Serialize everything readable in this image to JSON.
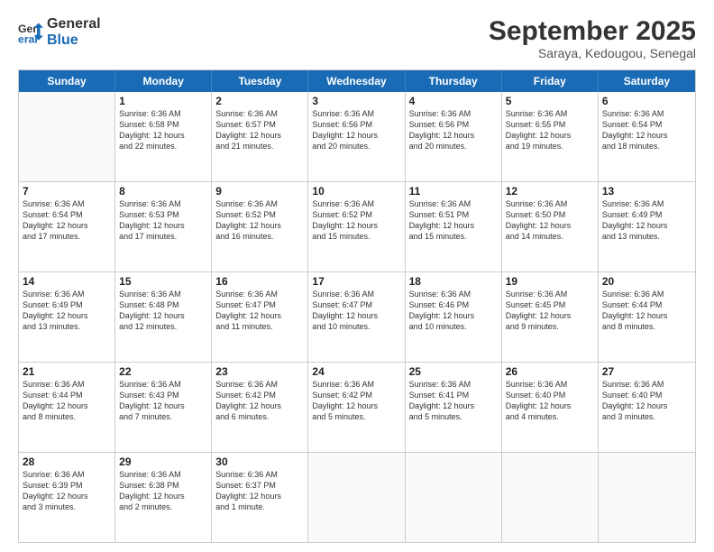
{
  "logo": {
    "line1": "General",
    "line2": "Blue"
  },
  "title": "September 2025",
  "subtitle": "Saraya, Kedougou, Senegal",
  "days": [
    "Sunday",
    "Monday",
    "Tuesday",
    "Wednesday",
    "Thursday",
    "Friday",
    "Saturday"
  ],
  "weeks": [
    [
      {
        "num": "",
        "info": ""
      },
      {
        "num": "1",
        "info": "Sunrise: 6:36 AM\nSunset: 6:58 PM\nDaylight: 12 hours\nand 22 minutes."
      },
      {
        "num": "2",
        "info": "Sunrise: 6:36 AM\nSunset: 6:57 PM\nDaylight: 12 hours\nand 21 minutes."
      },
      {
        "num": "3",
        "info": "Sunrise: 6:36 AM\nSunset: 6:56 PM\nDaylight: 12 hours\nand 20 minutes."
      },
      {
        "num": "4",
        "info": "Sunrise: 6:36 AM\nSunset: 6:56 PM\nDaylight: 12 hours\nand 20 minutes."
      },
      {
        "num": "5",
        "info": "Sunrise: 6:36 AM\nSunset: 6:55 PM\nDaylight: 12 hours\nand 19 minutes."
      },
      {
        "num": "6",
        "info": "Sunrise: 6:36 AM\nSunset: 6:54 PM\nDaylight: 12 hours\nand 18 minutes."
      }
    ],
    [
      {
        "num": "7",
        "info": "Sunrise: 6:36 AM\nSunset: 6:54 PM\nDaylight: 12 hours\nand 17 minutes."
      },
      {
        "num": "8",
        "info": "Sunrise: 6:36 AM\nSunset: 6:53 PM\nDaylight: 12 hours\nand 17 minutes."
      },
      {
        "num": "9",
        "info": "Sunrise: 6:36 AM\nSunset: 6:52 PM\nDaylight: 12 hours\nand 16 minutes."
      },
      {
        "num": "10",
        "info": "Sunrise: 6:36 AM\nSunset: 6:52 PM\nDaylight: 12 hours\nand 15 minutes."
      },
      {
        "num": "11",
        "info": "Sunrise: 6:36 AM\nSunset: 6:51 PM\nDaylight: 12 hours\nand 15 minutes."
      },
      {
        "num": "12",
        "info": "Sunrise: 6:36 AM\nSunset: 6:50 PM\nDaylight: 12 hours\nand 14 minutes."
      },
      {
        "num": "13",
        "info": "Sunrise: 6:36 AM\nSunset: 6:49 PM\nDaylight: 12 hours\nand 13 minutes."
      }
    ],
    [
      {
        "num": "14",
        "info": "Sunrise: 6:36 AM\nSunset: 6:49 PM\nDaylight: 12 hours\nand 13 minutes."
      },
      {
        "num": "15",
        "info": "Sunrise: 6:36 AM\nSunset: 6:48 PM\nDaylight: 12 hours\nand 12 minutes."
      },
      {
        "num": "16",
        "info": "Sunrise: 6:36 AM\nSunset: 6:47 PM\nDaylight: 12 hours\nand 11 minutes."
      },
      {
        "num": "17",
        "info": "Sunrise: 6:36 AM\nSunset: 6:47 PM\nDaylight: 12 hours\nand 10 minutes."
      },
      {
        "num": "18",
        "info": "Sunrise: 6:36 AM\nSunset: 6:46 PM\nDaylight: 12 hours\nand 10 minutes."
      },
      {
        "num": "19",
        "info": "Sunrise: 6:36 AM\nSunset: 6:45 PM\nDaylight: 12 hours\nand 9 minutes."
      },
      {
        "num": "20",
        "info": "Sunrise: 6:36 AM\nSunset: 6:44 PM\nDaylight: 12 hours\nand 8 minutes."
      }
    ],
    [
      {
        "num": "21",
        "info": "Sunrise: 6:36 AM\nSunset: 6:44 PM\nDaylight: 12 hours\nand 8 minutes."
      },
      {
        "num": "22",
        "info": "Sunrise: 6:36 AM\nSunset: 6:43 PM\nDaylight: 12 hours\nand 7 minutes."
      },
      {
        "num": "23",
        "info": "Sunrise: 6:36 AM\nSunset: 6:42 PM\nDaylight: 12 hours\nand 6 minutes."
      },
      {
        "num": "24",
        "info": "Sunrise: 6:36 AM\nSunset: 6:42 PM\nDaylight: 12 hours\nand 5 minutes."
      },
      {
        "num": "25",
        "info": "Sunrise: 6:36 AM\nSunset: 6:41 PM\nDaylight: 12 hours\nand 5 minutes."
      },
      {
        "num": "26",
        "info": "Sunrise: 6:36 AM\nSunset: 6:40 PM\nDaylight: 12 hours\nand 4 minutes."
      },
      {
        "num": "27",
        "info": "Sunrise: 6:36 AM\nSunset: 6:40 PM\nDaylight: 12 hours\nand 3 minutes."
      }
    ],
    [
      {
        "num": "28",
        "info": "Sunrise: 6:36 AM\nSunset: 6:39 PM\nDaylight: 12 hours\nand 3 minutes."
      },
      {
        "num": "29",
        "info": "Sunrise: 6:36 AM\nSunset: 6:38 PM\nDaylight: 12 hours\nand 2 minutes."
      },
      {
        "num": "30",
        "info": "Sunrise: 6:36 AM\nSunset: 6:37 PM\nDaylight: 12 hours\nand 1 minute."
      },
      {
        "num": "",
        "info": ""
      },
      {
        "num": "",
        "info": ""
      },
      {
        "num": "",
        "info": ""
      },
      {
        "num": "",
        "info": ""
      }
    ]
  ]
}
